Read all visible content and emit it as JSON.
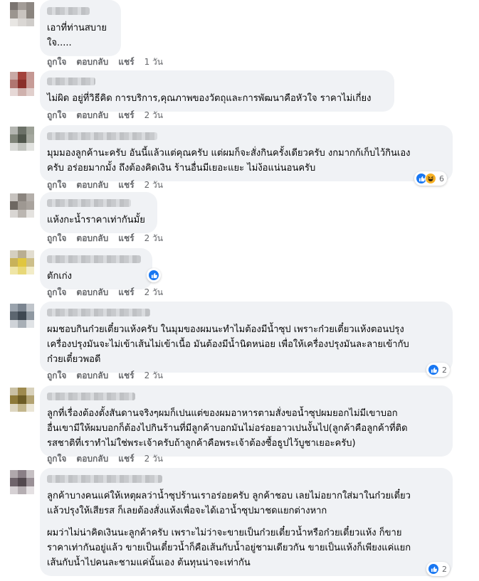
{
  "actions": {
    "like": "ถูกใจ",
    "reply": "ตอบกลับ",
    "share": "แชร์"
  },
  "icons": {
    "like": "like-thumb-icon",
    "haha": "haha-face-icon"
  },
  "colors": {
    "bubble": "#f0f2f5",
    "like_blue": "#1877f2",
    "haha_yellow": "#f7b125",
    "meta_gray": "#65676b"
  },
  "comments": [
    {
      "paragraphs": [
        "เอาที่ท่านสบาย\nใจ....."
      ],
      "time": "1 วัน"
    },
    {
      "paragraphs": [
        "ไม่ผิด อยู่ที่วิธีคิด การบริการ,คุณภาพของวัตถุและการพัฒนาคือหัวใจ ราคาไม่เกี่ยง"
      ],
      "time": "2 วัน"
    },
    {
      "paragraphs": [
        "มุมมองลูกค้านะครับ อันนี้แล้วแต่คุณครับ แต่ผมก็จะสั่งกินครั้งเดียวครับ งกมากก้เก็บไว้กินเอง\nครับ อร่อยมากมั้ง ถึงต้องคิดเงิน ร้านอื่นมีเยอะแยะ ไม่ง้อแน่นอนครับ"
      ],
      "time": "2 วัน",
      "reaction_count": "6"
    },
    {
      "paragraphs": [
        "แห้งกะน้ำราคาเท่ากันมั้ย"
      ],
      "time": "2 วัน"
    },
    {
      "paragraphs": [
        "ตักเก่ง"
      ],
      "time": "2 วัน"
    },
    {
      "paragraphs": [
        "ผมชอบกินก๋วยเตี๋ยวแห้งครับ ในมุมของผมนะทำไมต้องมีน้ำซุป เพราะก๋วยเตี๋ยวแห้งตอนปรุง\nเครื่องปรุงมันจะไม่เข้าเส้นไม่เข้าเนื้อ มันต้องมีน้ำนิดหน่อย เพื่อให้เครื่องปรุงมันละลายเข้ากับ\nก๋วยเตี๋ยวพอดี"
      ],
      "time": "2 วัน",
      "reaction_count": "2"
    },
    {
      "paragraphs": [
        "ลูกที่เรื่องต้องตั้งสันดานจริงๆผมก็เปนแต่ของผมอาหารตามสั่งขอน้ำซุปผมยอกไม่มีเขาบอก\nอื่นเขามีให้ผมบอกก็ต้องไปกินร้านที่มีลูกค้าบอกมันไม่อร่อยอาวเปนงั้นไป(ลูกค้าคือลูกค้าที่ติด\nรสชาติที่เราทำไม่ใช่พระเจ้าครับถ้าลูกค้าคือพระเจ้าต้องซื้อธูปไว้บูชาเยอะครับ)"
      ],
      "time": "2 วัน"
    },
    {
      "paragraphs": [
        "ลูกค้าบางคนแค่ให้เหตุผลว่าน้ำซุปร้านเราอร่อยครับ ลูกค้าชอบ เลยไม่อยากใส่มาในก๋วยเตี๋ยว\nแล้วปรุงให้เสียรส ก็เลยต้องสั่งแห้งเพื่อจะได้เอาน้ำซุปมาชดแยกต่างหาก",
        "ผมว่าไม่น่าคิดเงินนะลูกค้าครับ เพราะไม่ว่าจะขายเป็นก๋วยเตี๋ยวน้ำหรือก๋วยเตี๋ยวแห้ง ก็ขาย\nราคาเท่ากันอยู่แล้ว ขายเป็นเตี๋ยวน้ำก็คือเส้นกับน้ำอยู่ชามเดียวกัน ขายเป็นแห้งก็เพียงแค่แยก\nเส้นกับน้ำไปคนละชามแค่นั้นเอง ต้นทุนน่าจะเท่ากัน"
      ],
      "time": "",
      "reaction_count": "2"
    }
  ]
}
